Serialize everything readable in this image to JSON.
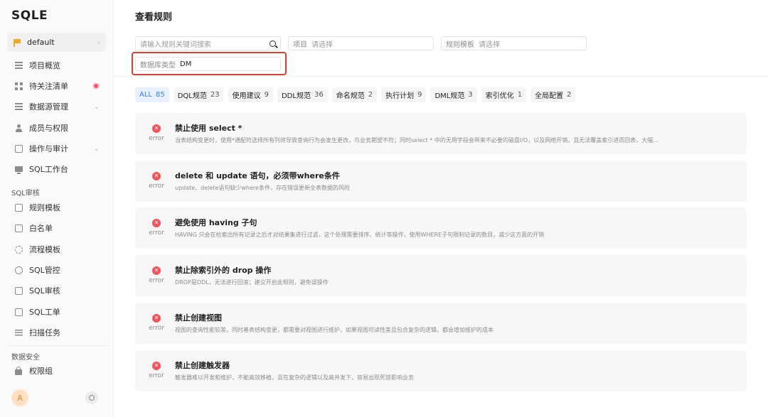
{
  "app": {
    "logo": "SQLE"
  },
  "project": {
    "name": "default"
  },
  "sidebar": {
    "items": [
      {
        "label": "项目概览"
      },
      {
        "label": "待关注清单"
      },
      {
        "label": "数据源管理"
      },
      {
        "label": "成员与权限"
      },
      {
        "label": "操作与审计"
      },
      {
        "label": "SQL工作台"
      }
    ],
    "section_sql_audit": "SQL审核",
    "audit_items": [
      {
        "label": "规则模板"
      },
      {
        "label": "白名单"
      },
      {
        "label": "流程模板"
      },
      {
        "label": "SQL管控"
      },
      {
        "label": "SQL审核"
      },
      {
        "label": "SQL工单"
      },
      {
        "label": "扫描任务"
      }
    ],
    "section_data_security": "数据安全",
    "security_items": [
      {
        "label": "权限组"
      }
    ],
    "user_initial": "A"
  },
  "page": {
    "title": "查看规则"
  },
  "filters": {
    "search_placeholder": "请输入规则关键词搜索",
    "project_label": "项目",
    "project_placeholder": "请选择",
    "template_label": "规则模板",
    "template_placeholder": "请选择",
    "dbtype_label": "数据库类型",
    "dbtype_value": "DM"
  },
  "tabs": [
    {
      "label": "ALL",
      "count": "85"
    },
    {
      "label": "DQL规范",
      "count": "23"
    },
    {
      "label": "使用建议",
      "count": "9"
    },
    {
      "label": "DDL规范",
      "count": "36"
    },
    {
      "label": "命名规范",
      "count": "2"
    },
    {
      "label": "执行计划",
      "count": "9"
    },
    {
      "label": "DML规范",
      "count": "3"
    },
    {
      "label": "索引优化",
      "count": "1"
    },
    {
      "label": "全局配置",
      "count": "2"
    }
  ],
  "rules": [
    {
      "level": "error",
      "name": "禁止使用 select *",
      "desc": "当表结构变更时，使用*通配符选择所有列将导致查询行为会发生更改，与业务期望不符；同时select * 中的无用字段会带来不必要的磁盘I/O，以及网络开销，且无法覆盖索引进而回表，大幅..."
    },
    {
      "level": "error",
      "name": "delete 和 update 语句，必须带where条件",
      "desc": "update、delete语句缺少where条件，存在错误更新全表数据的风险"
    },
    {
      "level": "error",
      "name": "避免使用 having 子句",
      "desc": "HAVING 只会在检索出所有记录之后才对结果集进行过滤，这个处理需要排序、统计等操作，使用WHERE子句限制记录的数目，减少这方面的开销"
    },
    {
      "level": "error",
      "name": "禁止除索引外的 drop 操作",
      "desc": "DROP是DDL，无法进行回滚；建议开启此规则，避免误操作"
    },
    {
      "level": "error",
      "name": "禁止创建视图",
      "desc": "视图的查询性能较差，同时基表结构变更，都需要对视图进行维护，如果视图可读性差且包含复杂的逻辑，都会增加维护的成本"
    },
    {
      "level": "error",
      "name": "禁止创建触发器",
      "desc": "触发器难以开发和维护，不能高效移植，且在复杂的逻辑以及高并发下，容易出现死锁影响业务"
    }
  ]
}
